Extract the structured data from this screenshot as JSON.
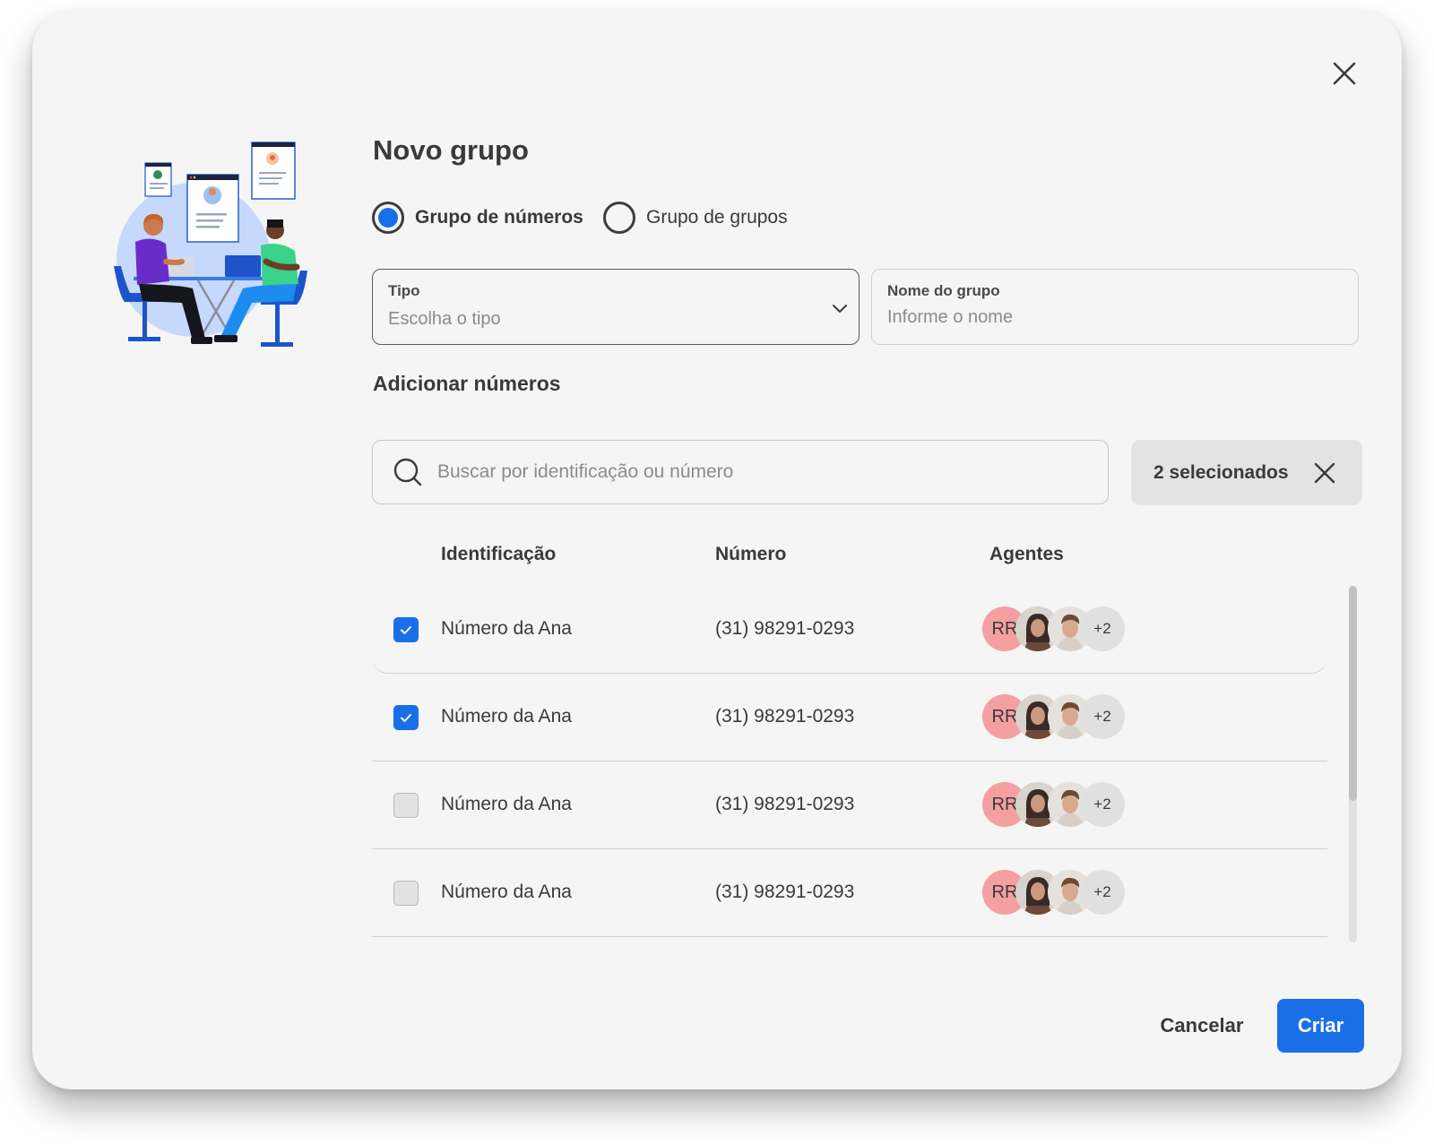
{
  "dialog": {
    "title": "Novo grupo",
    "close_icon": "close-icon",
    "illustration_icon": "team-working-illustration"
  },
  "group_type": {
    "options": [
      {
        "label": "Grupo de números",
        "selected": true
      },
      {
        "label": "Grupo de grupos",
        "selected": false
      }
    ]
  },
  "fields": {
    "tipo": {
      "label": "Tipo",
      "value": "",
      "placeholder": "Escolha o tipo",
      "icon": "chevron-down-icon"
    },
    "nome": {
      "label": "Nome do grupo",
      "value": "",
      "placeholder": "Informe o nome"
    }
  },
  "numbers": {
    "section_title": "Adicionar números",
    "search": {
      "value": "",
      "placeholder": "Buscar por identificação ou número",
      "icon": "search-icon"
    },
    "selected_chip": {
      "label": "2 selecionados",
      "icon": "close-icon"
    },
    "columns": [
      "Identificação",
      "Número",
      "Agentes"
    ],
    "rows": [
      {
        "checked": true,
        "identification": "Número da Ana",
        "number": "(31) 98291-0293",
        "agents": {
          "initials": "RR",
          "more": "+2"
        }
      },
      {
        "checked": true,
        "identification": "Número da Ana",
        "number": "(31) 98291-0293",
        "agents": {
          "initials": "RR",
          "more": "+2"
        }
      },
      {
        "checked": false,
        "identification": "Número da Ana",
        "number": "(31) 98291-0293",
        "agents": {
          "initials": "RR",
          "more": "+2"
        }
      },
      {
        "checked": false,
        "identification": "Número da Ana",
        "number": "(31) 98291-0293",
        "agents": {
          "initials": "RR",
          "more": "+2"
        }
      }
    ]
  },
  "actions": {
    "cancel_label": "Cancelar",
    "create_label": "Criar"
  },
  "colors": {
    "accent": "#1a6fe8",
    "avatar_initials_bg": "#f4a0a0",
    "background": "#f5f5f5"
  }
}
